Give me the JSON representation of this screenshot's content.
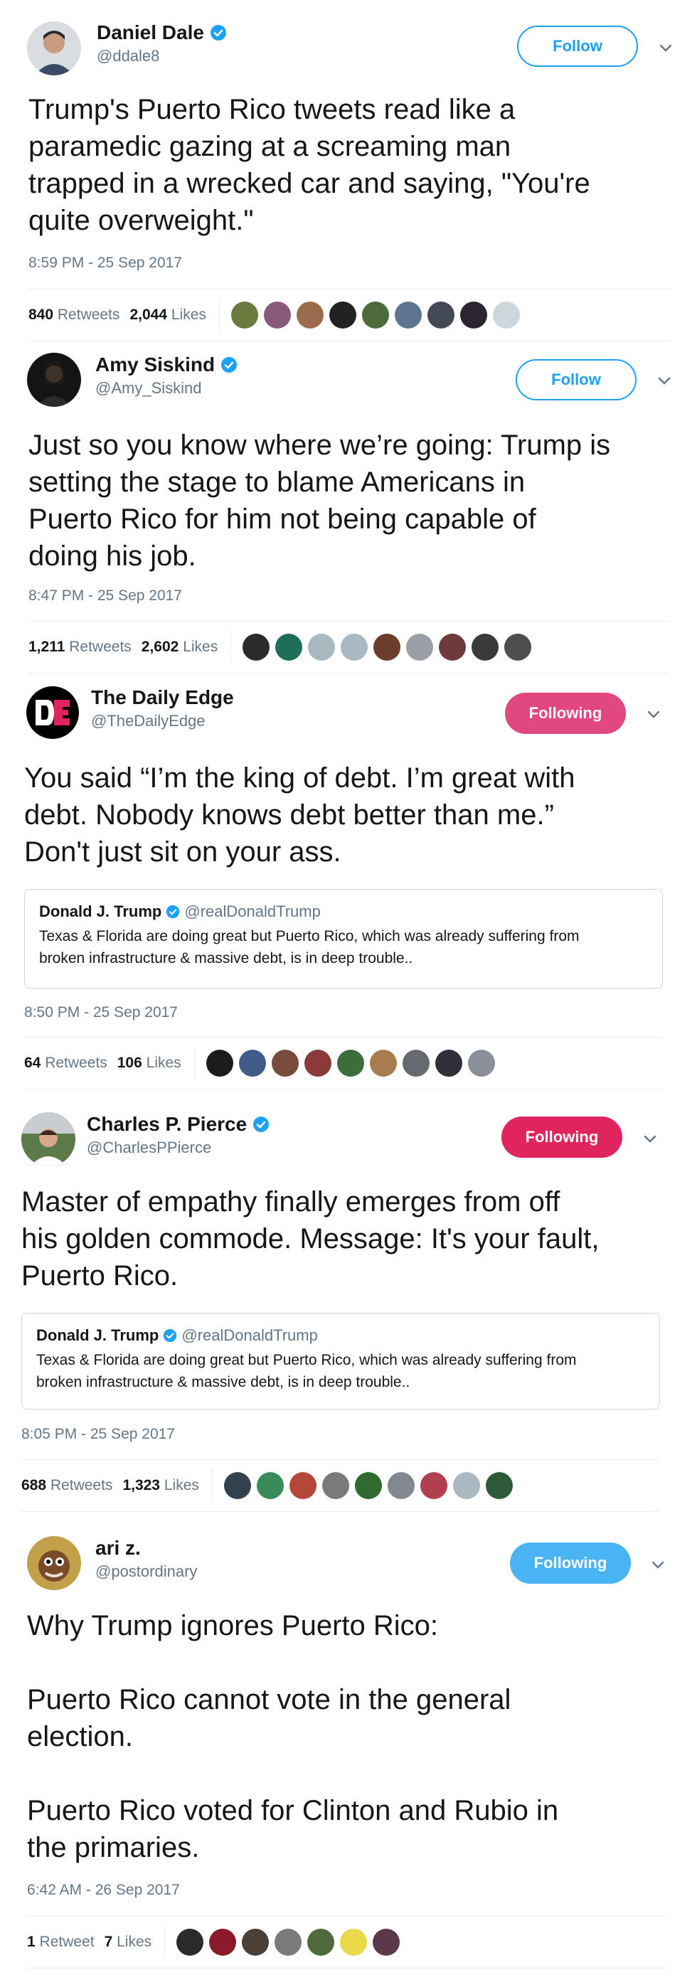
{
  "colors": {
    "follow_blue": "#1da1f2",
    "following_pink": "#e0487f",
    "following_red": "#e0245e",
    "following_lightblue": "#4ab3f4",
    "verified_blue": "#1da1f2",
    "secondary_text": "#657786"
  },
  "tweets": [
    {
      "name": "Daniel Dale",
      "handle": "@ddale8",
      "verified": true,
      "button": "Follow",
      "text": "Trump's Puerto Rico tweets read like a\nparamedic gazing at a screaming man\ntrapped in a wrecked car and saying, \"You're\nquite overweight.\"",
      "timestamp": "8:59 PM - 25 Sep 2017",
      "retweets": "840",
      "retweets_label": "Retweets",
      "likes": "2,044",
      "likes_label": "Likes"
    },
    {
      "name": "Amy Siskind",
      "handle": "@Amy_Siskind",
      "verified": true,
      "button": "Follow",
      "text": "Just so you know where we’re going: Trump is\nsetting the stage to blame Americans in\nPuerto Rico for him not being capable of\ndoing his job.",
      "timestamp": "8:47 PM - 25 Sep 2017",
      "retweets": "1,211",
      "retweets_label": "Retweets",
      "likes": "2,602",
      "likes_label": "Likes"
    },
    {
      "name": "The Daily Edge",
      "handle": "@TheDailyEdge",
      "verified": false,
      "button": "Following",
      "text": "You said “I’m the king of debt. I’m great with\ndebt. Nobody knows debt better than me.”\nDon't just sit on your ass.",
      "quote": {
        "name": "Donald J. Trump",
        "handle": "@realDonaldTrump",
        "text": "Texas & Florida are doing great but Puerto Rico, which was already suffering from\nbroken infrastructure & massive debt, is in deep trouble.."
      },
      "timestamp": "8:50 PM - 25 Sep 2017",
      "retweets": "64",
      "retweets_label": "Retweets",
      "likes": "106",
      "likes_label": "Likes"
    },
    {
      "name": "Charles P. Pierce",
      "handle": "@CharlesPPierce",
      "verified": true,
      "button": "Following",
      "text": "Master of empathy finally emerges from off\nhis golden commode. Message: It's your fault,\nPuerto Rico.",
      "quote": {
        "name": "Donald J. Trump",
        "handle": "@realDonaldTrump",
        "text": "Texas & Florida are doing great but Puerto Rico, which was already suffering from\nbroken infrastructure & massive debt, is in deep trouble.."
      },
      "timestamp": "8:05 PM - 25 Sep 2017",
      "retweets": "688",
      "retweets_label": "Retweets",
      "likes": "1,323",
      "likes_label": "Likes"
    },
    {
      "name": "ari z.",
      "handle": "@postordinary",
      "verified": false,
      "button": "Following",
      "text": "Why Trump ignores Puerto Rico:\n\nPuerto Rico cannot vote in the general\nelection.\n\nPuerto Rico voted for Clinton and Rubio in\nthe primaries.",
      "timestamp": "6:42 AM - 26 Sep 2017",
      "retweets": "1",
      "retweets_label": "Retweet",
      "likes": "7",
      "likes_label": "Likes"
    }
  ]
}
